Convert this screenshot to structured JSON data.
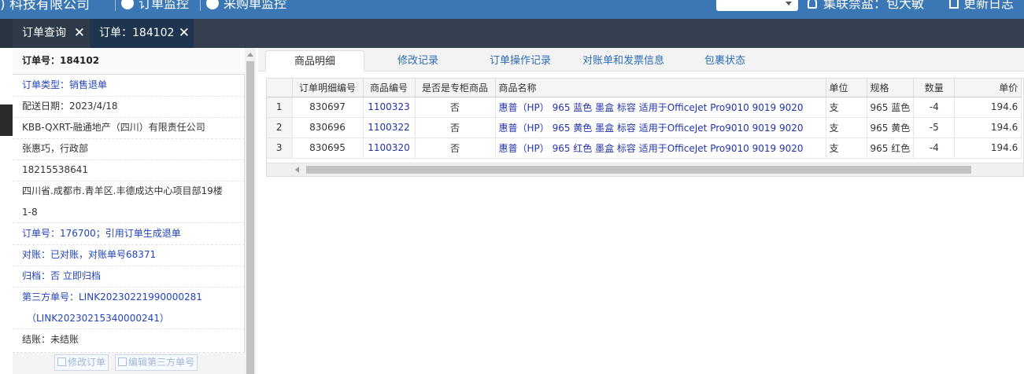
{
  "topbar": {
    "brand": ") 科技有限公司",
    "nav1": "订单监控",
    "nav2": "采购单监控",
    "user": "集联禁盐：包大敏",
    "log": "更新日志"
  },
  "tabs": [
    {
      "label": "订单查询"
    },
    {
      "label": "订单：184102"
    }
  ],
  "info": {
    "order_no": "订单号：184102",
    "order_type": "订单类型：销售退单",
    "ship_date": "配送日期：2023/4/18",
    "company": "KBB-QXRT-融通地产（四川）有限责任公司",
    "contact": "张惠巧，行政部",
    "phone": "18215538641",
    "address_line1": "四川省.成都市.青羊区.丰德成达中心项目部19楼",
    "address_line2": "1-8",
    "ref_order": "订单号：176700；引用订单生成退单",
    "reconcile": "对账：已对账，对账单号68371",
    "archive": "归档：否 立即归档",
    "third_party_line1": "第三方单号：LINK20230221990000281",
    "third_party_line2": "（LINK20230215340000241）",
    "settlement": "结账：未结账",
    "edit_order_btn": "修改订单",
    "edit_third_btn": "编辑第三方单号"
  },
  "subtabs": [
    {
      "label": "商品明细"
    },
    {
      "label": "修改记录"
    },
    {
      "label": "订单操作记录"
    },
    {
      "label": "对账单和发票信息"
    },
    {
      "label": "包裹状态"
    }
  ],
  "grid": {
    "headers": {
      "detail_no": "订单明细编号",
      "product_no": "商品编号",
      "special": "是否是专柜商品",
      "name": "商品名称",
      "unit": "单位",
      "spec": "规格",
      "qty": "数量",
      "price": "单价"
    },
    "rows": [
      {
        "rn": "1",
        "detail_no": "830697",
        "product_no": "1100323",
        "special": "否",
        "name": "惠普（HP） 965 蓝色 墨盒 标容 适用于OfficeJet Pro9010 9019 9020",
        "unit": "支",
        "spec": "965 蓝色",
        "qty": "-4",
        "price": "194.6"
      },
      {
        "rn": "2",
        "detail_no": "830696",
        "product_no": "1100322",
        "special": "否",
        "name": "惠普（HP） 965 黄色 墨盒 标容 适用于OfficeJet Pro9010 9019 9020",
        "unit": "支",
        "spec": "965 黄色",
        "qty": "-5",
        "price": "194.6"
      },
      {
        "rn": "3",
        "detail_no": "830695",
        "product_no": "1100320",
        "special": "否",
        "name": "惠普（HP） 965 红色 墨盒 标容 适用于OfficeJet Pro9010 9019 9020",
        "unit": "支",
        "spec": "965 红色",
        "qty": "-4",
        "price": "194.6"
      }
    ]
  }
}
